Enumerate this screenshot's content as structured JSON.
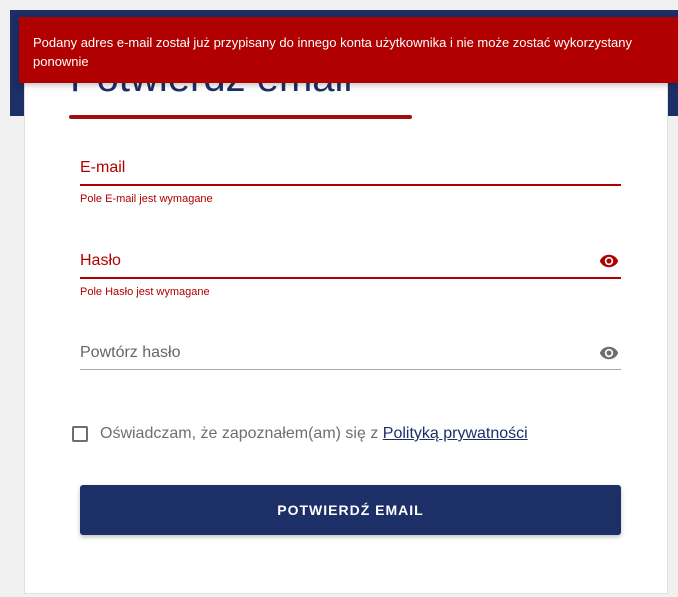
{
  "toast": {
    "message": "Podany adres e-mail został już przypisany do innego konta użytkownika i nie może zostać wykorzystany ponownie"
  },
  "page": {
    "title": "Potwierdź email"
  },
  "form": {
    "email": {
      "label": "E-mail",
      "value": "",
      "error": "Pole E-mail jest wymagane"
    },
    "password": {
      "label": "Hasło",
      "value": "",
      "error": "Pole Hasło jest wymagane",
      "toggle_icon": "eye-icon"
    },
    "repeat_password": {
      "label": "Powtórz hasło",
      "value": "",
      "toggle_icon": "eye-icon"
    },
    "consent": {
      "text": "Oświadczam, że zapoznałem(am) się z ",
      "link": "Polityką prywatności",
      "checked": false
    },
    "submit": {
      "label": "POTWIERDŹ EMAIL"
    }
  },
  "colors": {
    "brand_navy": "#1c2f66",
    "error_red": "#b00000",
    "neutral_gray": "#6e6e6e"
  }
}
